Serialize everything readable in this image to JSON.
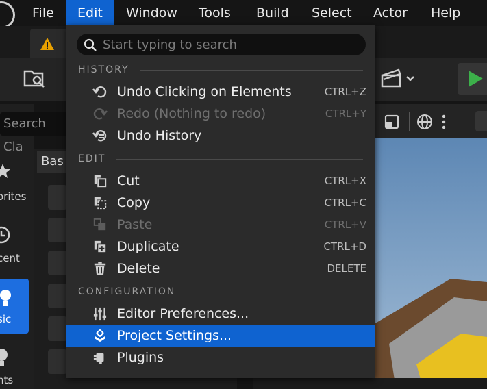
{
  "menubar": {
    "items": [
      {
        "label": "File"
      },
      {
        "label": "Edit"
      },
      {
        "label": "Window"
      },
      {
        "label": "Tools"
      },
      {
        "label": "Build"
      },
      {
        "label": "Select"
      },
      {
        "label": "Actor"
      },
      {
        "label": "Help"
      }
    ]
  },
  "left_panel": {
    "search_placeholder": "Search Cla",
    "tab_label": "Bas",
    "categories": [
      {
        "label": "orites",
        "icon": "star-icon"
      },
      {
        "label": "cent",
        "icon": "clock-icon"
      },
      {
        "label": "sic",
        "icon": "lightbulb-shapes-icon"
      },
      {
        "label": "hts",
        "icon": "lightbulb-icon"
      }
    ]
  },
  "dropdown": {
    "search_placeholder": "Start typing to search",
    "sections": {
      "history": "HISTORY",
      "edit": "EDIT",
      "configuration": "CONFIGURATION"
    },
    "items": {
      "undo": {
        "label": "Undo Clicking on Elements",
        "shortcut": "CTRL+Z",
        "icon": "undo-icon"
      },
      "redo": {
        "label": "Redo (Nothing to redo)",
        "shortcut": "CTRL+Y",
        "icon": "redo-icon"
      },
      "undo_history": {
        "label": "Undo History",
        "icon": "undo-history-icon"
      },
      "cut": {
        "label": "Cut",
        "shortcut": "CTRL+X",
        "icon": "cut-icon"
      },
      "copy": {
        "label": "Copy",
        "shortcut": "CTRL+C",
        "icon": "copy-icon"
      },
      "paste": {
        "label": "Paste",
        "shortcut": "CTRL+V",
        "icon": "paste-icon"
      },
      "duplicate": {
        "label": "Duplicate",
        "shortcut": "CTRL+D",
        "icon": "duplicate-icon"
      },
      "delete": {
        "label": "Delete",
        "shortcut": "DELETE",
        "icon": "trash-icon"
      },
      "editor_preferences": {
        "label": "Editor Preferences...",
        "icon": "sliders-icon"
      },
      "project_settings": {
        "label": "Project Settings...",
        "icon": "project-settings-icon"
      },
      "plugins": {
        "label": "Plugins",
        "icon": "plug-icon"
      }
    }
  },
  "colors": {
    "accent": "#0f63d0",
    "menu_bg": "#2b2b2b",
    "play_green": "#3cb04a"
  }
}
